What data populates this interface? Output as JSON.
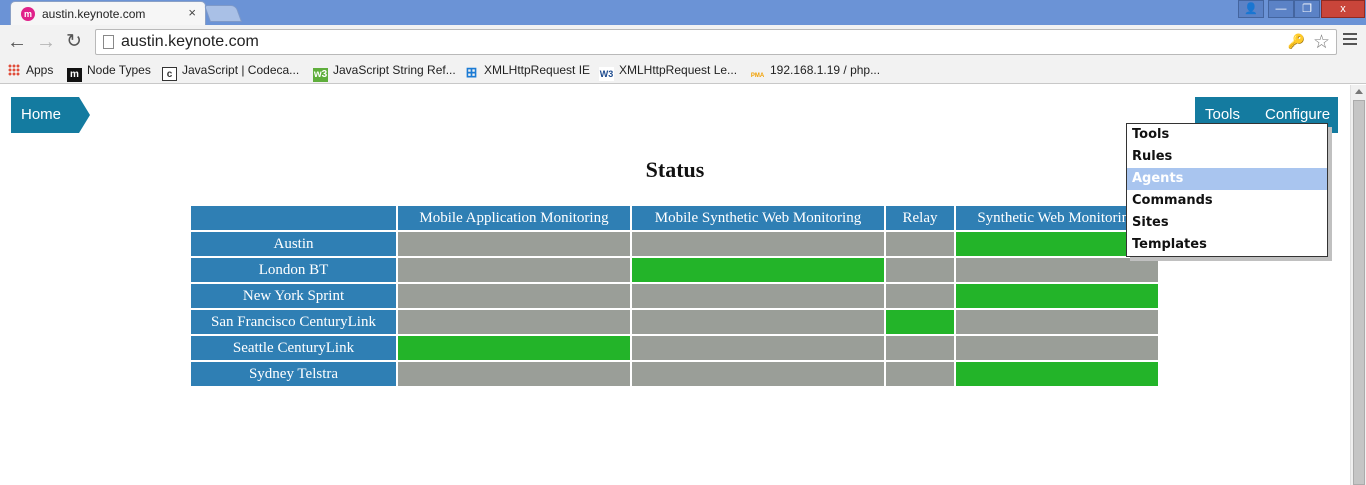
{
  "browser": {
    "tab": {
      "favicon": "keynote-favicon",
      "title": "austin.keynote.com",
      "close_glyph": "×"
    },
    "window_controls": {
      "user_glyph": "👤",
      "minimize_glyph": "—",
      "maximize_glyph": "❐",
      "close_glyph": "x"
    },
    "toolbar": {
      "back_glyph": "←",
      "forward_glyph": "→",
      "reload_glyph": "↻",
      "url": "austin.keynote.com",
      "key_glyph": "🔑",
      "star_glyph": "☆"
    },
    "bookmarks": [
      {
        "label": "Apps",
        "icon": "apps-grid-icon"
      },
      {
        "label": "Node Types",
        "icon": "m-icon",
        "glyph": "m",
        "color": "#111111"
      },
      {
        "label": "JavaScript | Codeca...",
        "icon": "codecademy-icon",
        "glyph": "c",
        "color": "#ffffff"
      },
      {
        "label": "JavaScript String Ref...",
        "icon": "w3schools-icon",
        "glyph": "w3",
        "color": "#5fae3c"
      },
      {
        "label": "XMLHttpRequest IE",
        "icon": "windows-icon",
        "glyph": "⊞",
        "color": "#1c7bd4"
      },
      {
        "label": "XMLHttpRequest Le...",
        "icon": "w3c-icon",
        "glyph": "W3",
        "color": "#1e4b8f"
      },
      {
        "label": "192.168.1.19 / php...",
        "icon": "phpmyadmin-icon",
        "glyph": "PMA",
        "color": "#f2a000"
      }
    ]
  },
  "nav": {
    "home_label": "Home",
    "tools_label": "Tools",
    "configure_label": "Configure",
    "dropdown": [
      "Tools",
      "Rules",
      "Agents",
      "Commands",
      "Sites",
      "Templates"
    ],
    "dropdown_active": "Agents"
  },
  "status": {
    "title": "Status",
    "columns": [
      "",
      "Mobile Application Monitoring",
      "Mobile Synthetic Web Monitoring",
      "Relay",
      "Synthetic Web Monitoring"
    ],
    "rows": [
      {
        "name": "Austin",
        "cells": [
          false,
          false,
          false,
          true
        ]
      },
      {
        "name": "London BT",
        "cells": [
          false,
          true,
          false,
          false
        ]
      },
      {
        "name": "New York Sprint",
        "cells": [
          false,
          false,
          false,
          true
        ]
      },
      {
        "name": "San Francisco CenturyLink",
        "cells": [
          false,
          false,
          true,
          false
        ]
      },
      {
        "name": "Seattle CenturyLink",
        "cells": [
          true,
          false,
          false,
          false
        ]
      },
      {
        "name": "Sydney Telstra",
        "cells": [
          false,
          false,
          false,
          true
        ]
      }
    ],
    "colors": {
      "header": "#2f7fb4",
      "on": "#23b429",
      "off": "#9a9e98"
    }
  }
}
